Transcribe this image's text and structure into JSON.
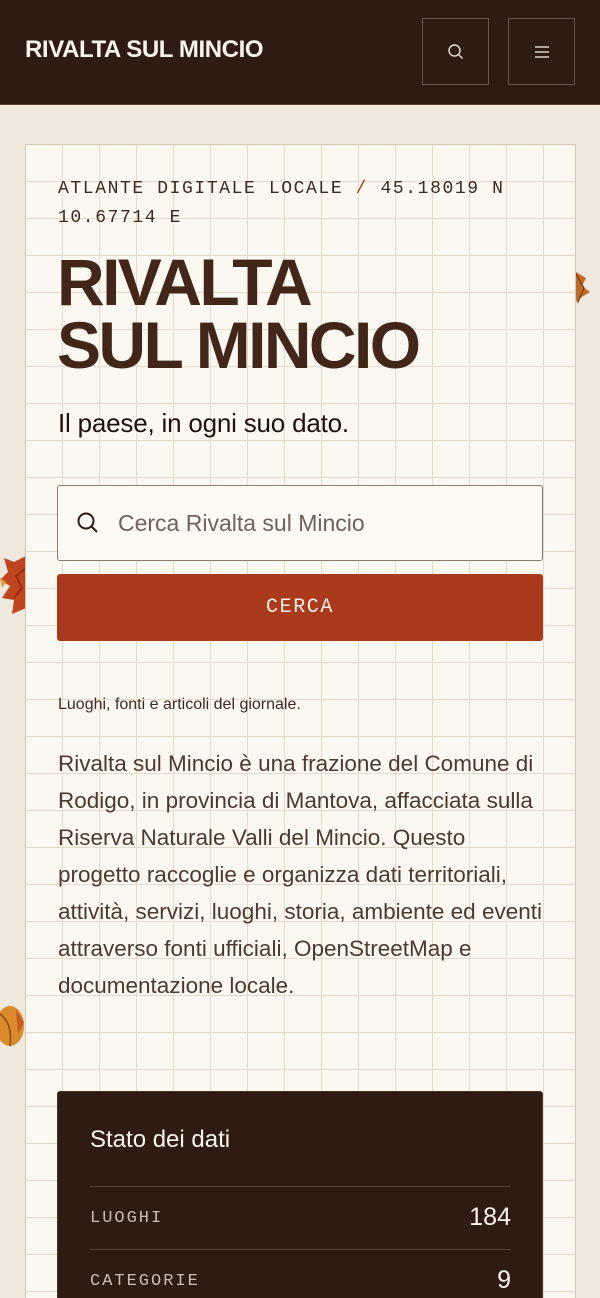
{
  "header": {
    "brand": "RIVALTA SUL MINCIO",
    "search_icon": "search-icon",
    "menu_icon": "menu-icon"
  },
  "hero": {
    "eyebrow_prefix": "ATLANTE DIGITALE LOCALE",
    "eyebrow_sep": "/",
    "coordinates": "45.18019 N 10.67714 E",
    "title_line1": "RIVALTA",
    "title_line2": "SUL MINCIO",
    "tagline": "Il paese, in ogni suo dato."
  },
  "search": {
    "placeholder": "Cerca Rivalta sul Mincio",
    "value": "",
    "button_label": "CERCA",
    "note": "Luoghi, fonti e articoli del giornale."
  },
  "description": "Rivalta sul Mincio è una frazione del Comune di Rodigo, in provincia di Mantova, affacciata sulla Riserva Naturale Valli del Mincio. Questo progetto raccoglie e organizza dati territoriali, attività, servizi, luoghi, storia, ambiente ed eventi attraverso fonti ufficiali, OpenStreetMap e documentazione locale.",
  "status": {
    "title": "Stato dei dati",
    "rows": [
      {
        "label": "LUOGHI",
        "value": "184"
      },
      {
        "label": "CATEGORIE",
        "value": "9"
      }
    ]
  },
  "colors": {
    "header_bg": "#2e1c12",
    "accent": "#a93a1c",
    "page_bg": "#efe8dc",
    "card_bg": "#fbf8f1"
  }
}
